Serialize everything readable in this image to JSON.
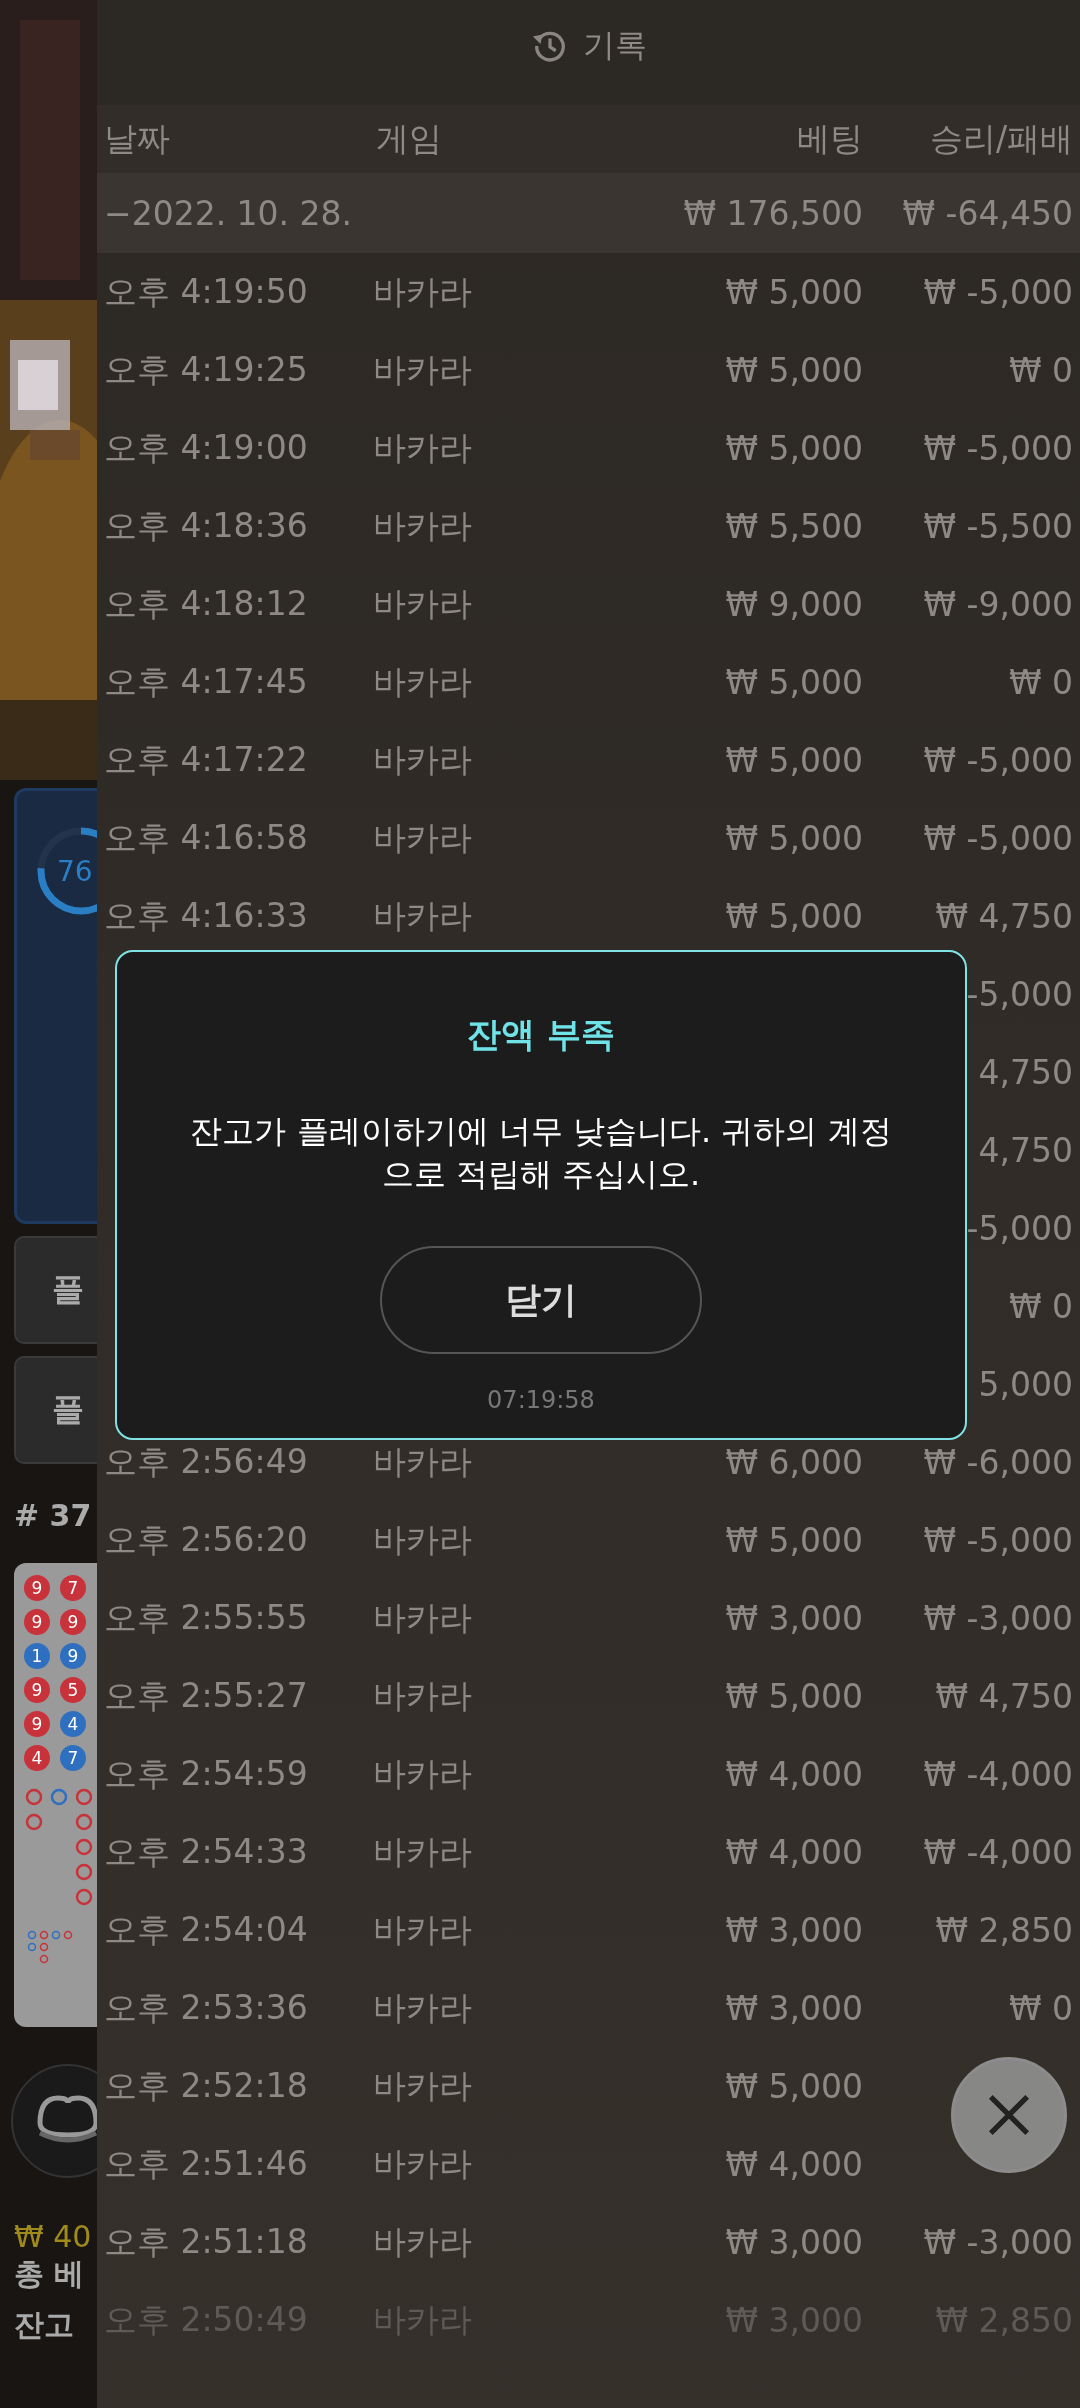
{
  "side": {
    "progress": {
      "label": "76"
    },
    "buttons": [
      "플",
      "플"
    ],
    "round": "# 37",
    "beads": [
      {
        "n": "9",
        "color": "#c8323a"
      },
      {
        "n": "7",
        "color": "#c8323a"
      },
      {
        "n": "9",
        "color": "#c8323a"
      },
      {
        "n": "9",
        "color": "#c8323a"
      },
      {
        "n": "1",
        "color": "#2f6fc0"
      },
      {
        "n": "9",
        "color": "#2f6fc0"
      },
      {
        "n": "9",
        "color": "#c8323a"
      },
      {
        "n": "5",
        "color": "#c8323a"
      },
      {
        "n": "9",
        "color": "#c8323a"
      },
      {
        "n": "4",
        "color": "#2f6fc0"
      },
      {
        "n": "4",
        "color": "#c8323a"
      },
      {
        "n": "7",
        "color": "#2f6fc0"
      }
    ],
    "amount": "₩ 40",
    "total_bet": "총 베",
    "balance_label": "잔고"
  },
  "history": {
    "title": "기록",
    "columns": [
      "날짜",
      "게임",
      "베팅",
      "승리/패배"
    ],
    "group": {
      "date": "−2022. 10. 28.",
      "bet": "₩ 176,500",
      "result": "₩ -64,450"
    },
    "rows": [
      {
        "time": "오후 4:19:50",
        "game": "바카라",
        "bet": "₩ 5,000",
        "result": "₩ -5,000"
      },
      {
        "time": "오후 4:19:25",
        "game": "바카라",
        "bet": "₩ 5,000",
        "result": "₩ 0"
      },
      {
        "time": "오후 4:19:00",
        "game": "바카라",
        "bet": "₩ 5,000",
        "result": "₩ -5,000"
      },
      {
        "time": "오후 4:18:36",
        "game": "바카라",
        "bet": "₩ 5,500",
        "result": "₩ -5,500"
      },
      {
        "time": "오후 4:18:12",
        "game": "바카라",
        "bet": "₩ 9,000",
        "result": "₩ -9,000"
      },
      {
        "time": "오후 4:17:45",
        "game": "바카라",
        "bet": "₩ 5,000",
        "result": "₩ 0"
      },
      {
        "time": "오후 4:17:22",
        "game": "바카라",
        "bet": "₩ 5,000",
        "result": "₩ -5,000"
      },
      {
        "time": "오후 4:16:58",
        "game": "바카라",
        "bet": "₩ 5,000",
        "result": "₩ -5,000"
      },
      {
        "time": "오후 4:16:33",
        "game": "바카라",
        "bet": "₩ 5,000",
        "result": "₩ 4,750"
      },
      {
        "result": "-5,000"
      },
      {
        "result": "4,750"
      },
      {
        "result": "4,750"
      },
      {
        "result": "-5,000"
      },
      {
        "result": "₩ 0"
      },
      {
        "result": "5,000"
      },
      {
        "time": "오후 2:56:49",
        "game": "바카라",
        "bet": "₩ 6,000",
        "result": "₩ -6,000"
      },
      {
        "time": "오후 2:56:20",
        "game": "바카라",
        "bet": "₩ 5,000",
        "result": "₩ -5,000"
      },
      {
        "time": "오후 2:55:55",
        "game": "바카라",
        "bet": "₩ 3,000",
        "result": "₩ -3,000"
      },
      {
        "time": "오후 2:55:27",
        "game": "바카라",
        "bet": "₩ 5,000",
        "result": "₩ 4,750"
      },
      {
        "time": "오후 2:54:59",
        "game": "바카라",
        "bet": "₩ 4,000",
        "result": "₩ -4,000"
      },
      {
        "time": "오후 2:54:33",
        "game": "바카라",
        "bet": "₩ 4,000",
        "result": "₩ -4,000"
      },
      {
        "time": "오후 2:54:04",
        "game": "바카라",
        "bet": "₩ 3,000",
        "result": "₩ 2,850"
      },
      {
        "time": "오후 2:53:36",
        "game": "바카라",
        "bet": "₩ 3,000",
        "result": "₩ 0"
      },
      {
        "time": "오후 2:52:18",
        "game": "바카라",
        "bet": "₩ 5,000"
      },
      {
        "time": "오후 2:51:46",
        "game": "바카라",
        "bet": "₩ 4,000"
      },
      {
        "time": "오후 2:51:18",
        "game": "바카라",
        "bet": "₩ 3,000",
        "result": "₩ -3,000"
      },
      {
        "time": "오후 2:50:49",
        "game": "바카라",
        "bet": "₩ 3,000",
        "result": "₩ 2,850",
        "faded": true
      }
    ]
  },
  "dialog": {
    "title": "잔액 부족",
    "message": "잔고가 플레이하기에 너무 낮습니다. 귀하의 계정으로 적립해 주십시오.",
    "button": "닫기",
    "time": "07:19:58"
  }
}
